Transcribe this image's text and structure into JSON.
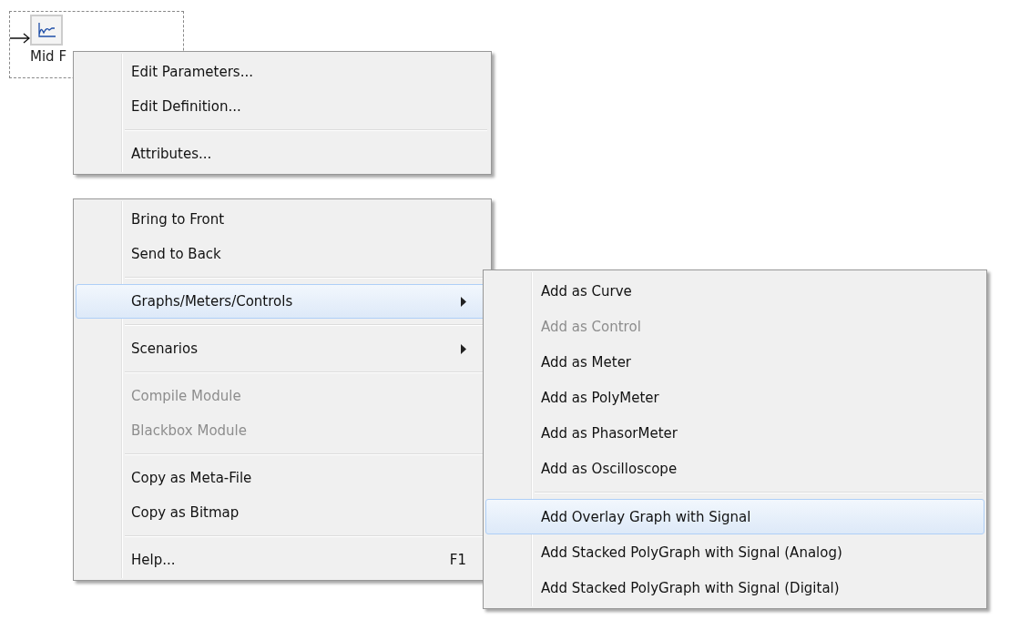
{
  "canvas_block": {
    "label": "Mid F"
  },
  "context_menu": {
    "panels": [
      {
        "groups": [
          [
            {
              "label": "Edit Parameters...",
              "disabled": false,
              "selected": false,
              "submenu": false
            },
            {
              "label": "Edit Definition...",
              "disabled": false,
              "selected": false,
              "submenu": false
            }
          ],
          [
            {
              "label": "Attributes...",
              "disabled": false,
              "selected": false,
              "submenu": false
            }
          ]
        ]
      },
      {
        "groups": [
          [
            {
              "label": "Bring to Front",
              "disabled": false,
              "selected": false,
              "submenu": false
            },
            {
              "label": "Send to Back",
              "disabled": false,
              "selected": false,
              "submenu": false
            }
          ],
          [
            {
              "label": "Graphs/Meters/Controls",
              "disabled": false,
              "selected": true,
              "submenu": true
            }
          ],
          [
            {
              "label": "Scenarios",
              "disabled": false,
              "selected": false,
              "submenu": true
            }
          ],
          [
            {
              "label": "Compile Module",
              "disabled": true,
              "selected": false,
              "submenu": false
            },
            {
              "label": "Blackbox Module",
              "disabled": true,
              "selected": false,
              "submenu": false
            }
          ],
          [
            {
              "label": "Copy as Meta-File",
              "disabled": false,
              "selected": false,
              "submenu": false
            },
            {
              "label": "Copy as Bitmap",
              "disabled": false,
              "selected": false,
              "submenu": false
            }
          ],
          [
            {
              "label": "Help...",
              "shortcut": "F1",
              "disabled": false,
              "selected": false,
              "submenu": false
            }
          ]
        ]
      }
    ]
  },
  "submenu": {
    "groups": [
      [
        {
          "label": "Add as Curve",
          "disabled": false,
          "selected": false
        },
        {
          "label": "Add as Control",
          "disabled": true,
          "selected": false
        },
        {
          "label": "Add as Meter",
          "disabled": false,
          "selected": false
        },
        {
          "label": "Add as PolyMeter",
          "disabled": false,
          "selected": false
        },
        {
          "label": "Add as PhasorMeter",
          "disabled": false,
          "selected": false
        },
        {
          "label": "Add as Oscilloscope",
          "disabled": false,
          "selected": false
        }
      ],
      [
        {
          "label": "Add Overlay Graph with Signal",
          "disabled": false,
          "selected": true
        },
        {
          "label": "Add Stacked PolyGraph with Signal (Analog)",
          "disabled": false,
          "selected": false
        },
        {
          "label": "Add Stacked PolyGraph with Signal (Digital)",
          "disabled": false,
          "selected": false
        }
      ]
    ]
  }
}
